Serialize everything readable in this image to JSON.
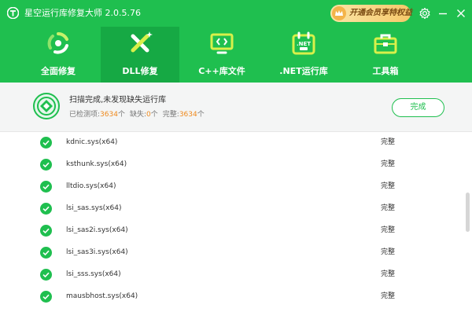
{
  "app": {
    "title": "星空运行库修复大师 2.0.5.76"
  },
  "titlebar": {
    "vip_label": "开通会员享特权益"
  },
  "nav": {
    "tabs": [
      {
        "label": "全面修复",
        "icon": "repair-cycle-icon",
        "active": false
      },
      {
        "label": "DLL修复",
        "icon": "dll-tools-icon",
        "active": true
      },
      {
        "label": "C++库文件",
        "icon": "code-monitor-icon",
        "active": false
      },
      {
        "label": ".NET运行库",
        "icon": "dotnet-calendar-icon",
        "active": false
      },
      {
        "label": "工具箱",
        "icon": "toolbox-icon",
        "active": false
      }
    ]
  },
  "status": {
    "title": "扫描完成,未发现缺失运行库",
    "checked_label": "已检测项:",
    "checked_value": "3634",
    "checked_unit": "个",
    "missing_label": "缺失:",
    "missing_value": "0",
    "missing_unit": "个",
    "complete_label": "完整:",
    "complete_value": "3634",
    "complete_unit": "个",
    "done_button": "完成"
  },
  "files": [
    {
      "name": "kdnic.sys(x64)",
      "status": "完整"
    },
    {
      "name": "ksthunk.sys(x64)",
      "status": "完整"
    },
    {
      "name": "lltdio.sys(x64)",
      "status": "完整"
    },
    {
      "name": "lsi_sas.sys(x64)",
      "status": "完整"
    },
    {
      "name": "lsi_sas2i.sys(x64)",
      "status": "完整"
    },
    {
      "name": "lsi_sas3i.sys(x64)",
      "status": "完整"
    },
    {
      "name": "lsi_sss.sys(x64)",
      "status": "完整"
    },
    {
      "name": "mausbhost.sys(x64)",
      "status": "完整"
    }
  ],
  "colors": {
    "brand": "#1fbf4f",
    "brand_dark": "#16a944",
    "count_highlight": "#ef8a1e"
  }
}
